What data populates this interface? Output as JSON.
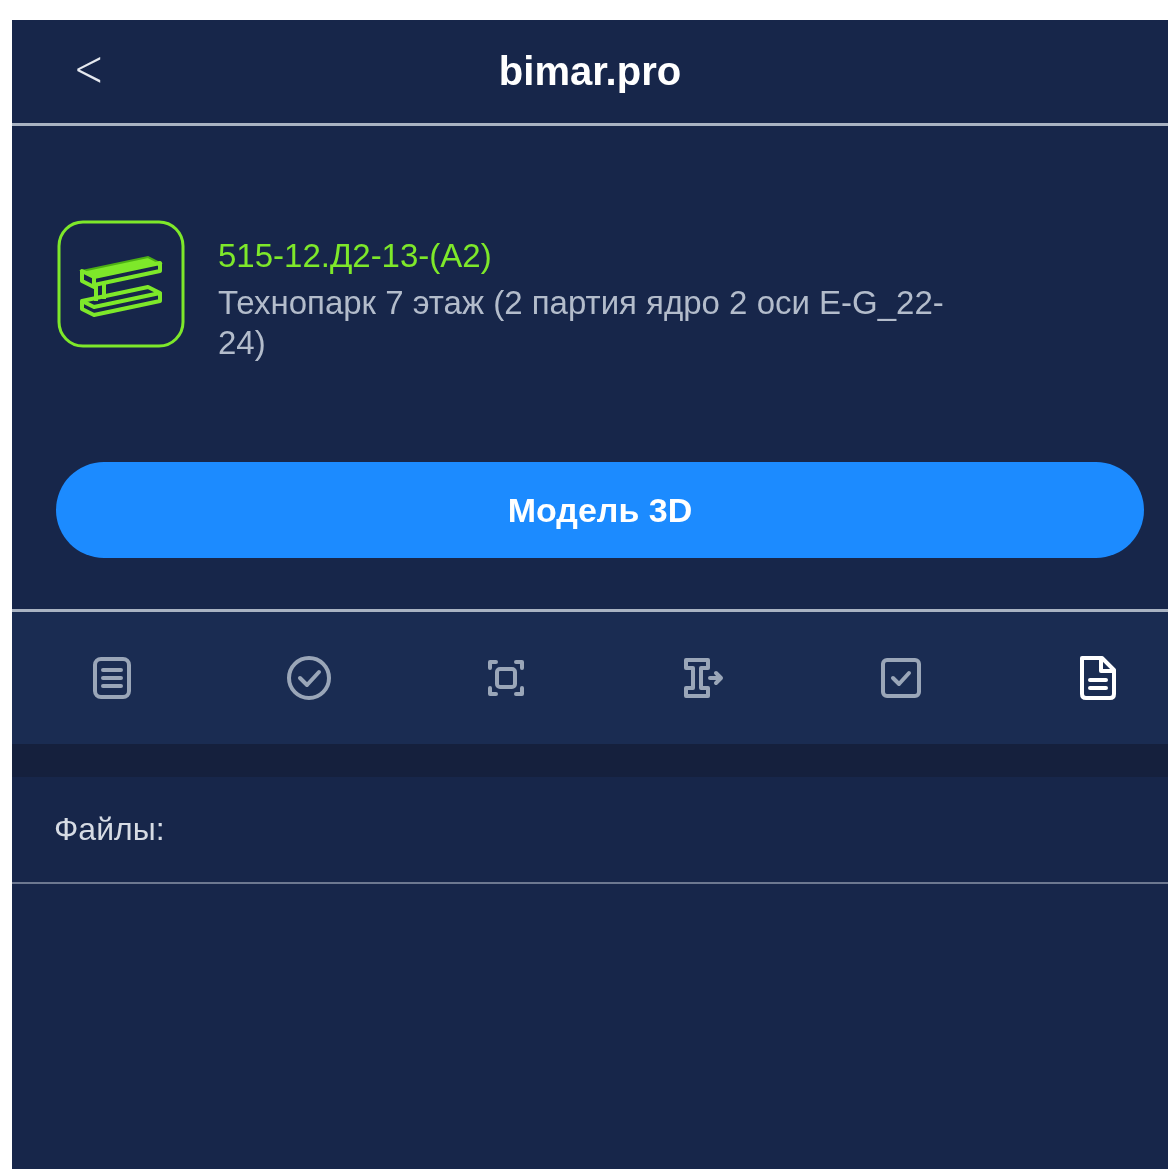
{
  "header": {
    "back": "<",
    "title": "bimar.pro"
  },
  "element": {
    "code": "515-12.Д2-13-(А2)",
    "description": "Технопарк 7 этаж (2 партия ядро 2 оси E-G_22-24)"
  },
  "model_button": "Модель 3D",
  "tabs": [
    {
      "kind": "list",
      "selected": false
    },
    {
      "kind": "check-circle",
      "selected": false
    },
    {
      "kind": "scan",
      "selected": false
    },
    {
      "kind": "beam-export",
      "selected": false
    },
    {
      "kind": "checkbox",
      "selected": false
    },
    {
      "kind": "document",
      "selected": true
    }
  ],
  "files_label": "Файлы:"
}
